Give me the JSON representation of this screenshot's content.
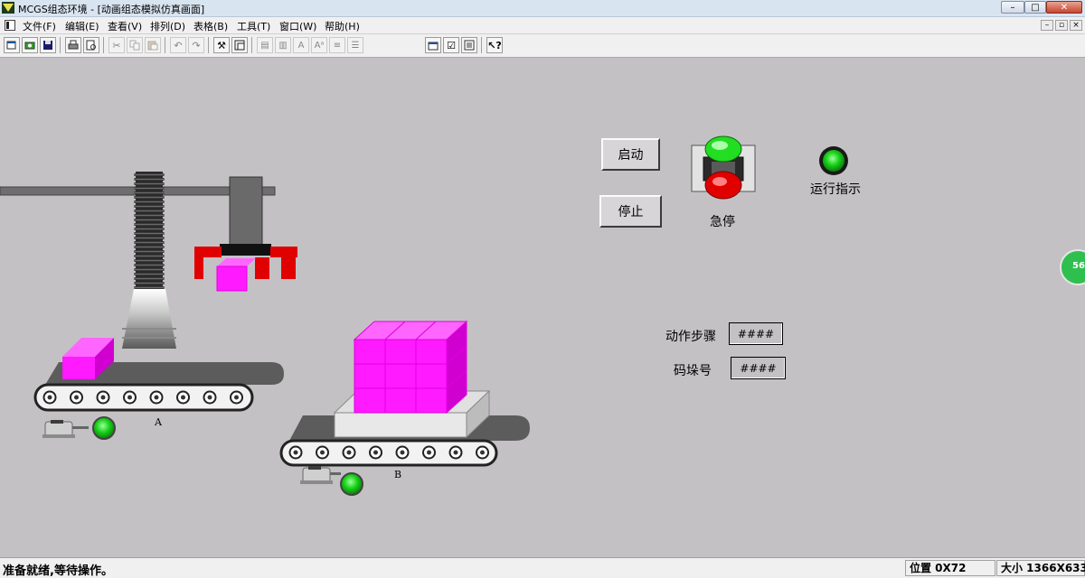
{
  "window": {
    "title": "MCGS组态环境 - [动画组态模拟仿真画面]",
    "minimize": "–",
    "maximize": "□",
    "close": "✕"
  },
  "menu": {
    "items": [
      "文件(F)",
      "编辑(E)",
      "查看(V)",
      "排列(D)",
      "表格(B)",
      "工具(T)",
      "窗口(W)",
      "帮助(H)"
    ],
    "mdi": [
      "–",
      "▫",
      "×"
    ]
  },
  "toolbar": {
    "icons": [
      "new-window-icon",
      "open-icon",
      "save-icon",
      "print-icon",
      "print-preview-icon",
      "cut-icon",
      "copy-icon",
      "paste-icon",
      "undo-icon",
      "redo-icon",
      "tools-icon",
      "frame-icon",
      "align-left-icon",
      "align-center-icon",
      "font-icon",
      "line-icon",
      "list-icon",
      "properties-icon",
      "check-icon",
      "export-icon",
      "help-icon"
    ]
  },
  "canvas": {
    "start_button": "启动",
    "stop_button": "停止",
    "estop_label": "急停",
    "run_indicator_label": "运行指示",
    "step_label": "动作步骤",
    "step_value": "####",
    "stack_label": "码垛号",
    "stack_value": "####",
    "conveyor_a_label": "A",
    "conveyor_b_label": "B",
    "side_badge": "56"
  },
  "status": {
    "message": "准备就绪,等待操作。",
    "position": "位置 0X72",
    "size": "大小 1366X633"
  },
  "colors": {
    "canvas": "#c4c1c4",
    "box": "#ff1aff",
    "gripper": "#e00000",
    "lamp_green": "#19d319"
  }
}
